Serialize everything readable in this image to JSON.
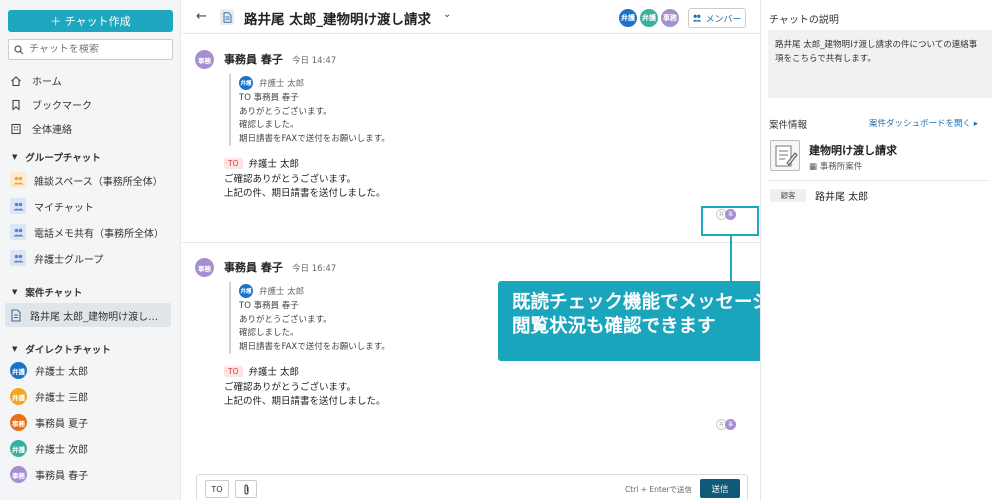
{
  "sidebar": {
    "new_chat_label": "＋ チャット作成",
    "search_placeholder": "チャットを検索",
    "nav": [
      {
        "label": "ホーム",
        "icon": "home-icon"
      },
      {
        "label": "ブックマーク",
        "icon": "bookmark-icon"
      },
      {
        "label": "全体連絡",
        "icon": "building-icon"
      }
    ],
    "group_section": "グループチャット",
    "groups": [
      {
        "label": "雑談スペース（事務所全体）",
        "color": "#f3a33a"
      },
      {
        "label": "マイチャット",
        "color": "#5b86c5"
      },
      {
        "label": "電話メモ共有（事務所全体）",
        "color": "#5b86c5"
      },
      {
        "label": "弁護士グループ",
        "color": "#5b86c5"
      }
    ],
    "case_section": "案件チャット",
    "cases": [
      {
        "label": "路井尾 太郎_建物明け渡し…"
      }
    ],
    "dm_section": "ダイレクトチャット",
    "dms": [
      {
        "avatar": "弁護",
        "label": "弁護士 太郎",
        "color": "#1a73c8"
      },
      {
        "avatar": "弁護",
        "label": "弁護士 三郎",
        "color": "#f4a623"
      },
      {
        "avatar": "事務",
        "label": "事務員 夏子",
        "color": "#e8701a"
      },
      {
        "avatar": "弁護",
        "label": "弁護士 次郎",
        "color": "#3ab0a0"
      },
      {
        "avatar": "事務",
        "label": "事務員 春子",
        "color": "#a58fd0"
      }
    ]
  },
  "header": {
    "back": "←",
    "title": "路井尾 太郎_建物明け渡し請求",
    "chevron": "⌄",
    "members": [
      {
        "label": "弁護",
        "color": "#1a73c8"
      },
      {
        "label": "弁護",
        "color": "#3ab0a0"
      },
      {
        "label": "事務",
        "color": "#a58fd0"
      }
    ],
    "member_btn": "メンバー"
  },
  "messages": [
    {
      "avatar": "事務",
      "name": "事務員 春子",
      "time": "今日 14:47",
      "quote_avatar": "弁護",
      "quote_author": "弁護士 太郎",
      "quote_lines": [
        "TO 事務員 春子",
        "ありがとうございます。",
        "確認しました。",
        "期日請書をFAXで送付をお願いします。"
      ],
      "to_tag": "TO",
      "to_name": "弁護士 太郎",
      "body": [
        "ご確認ありがとうございます。",
        "上記の件、期日請書を送付しました。"
      ],
      "read_marks": [
        "弁",
        "事"
      ]
    },
    {
      "avatar": "事務",
      "name": "事務員 春子",
      "time": "今日 16:47",
      "quote_avatar": "弁護",
      "quote_author": "弁護士 太郎",
      "quote_lines": [
        "TO 事務員 春子",
        "ありがとうございます。",
        "確認しました。",
        "期日請書をFAXで送付をお願いします。"
      ],
      "to_tag": "TO",
      "to_name": "弁護士 太郎",
      "body": [
        "ご確認ありがとうございます。",
        "上記の件、期日請書を送付しました。"
      ],
      "read_marks": [
        "弁",
        "事"
      ]
    }
  ],
  "callout": {
    "line1": "既読チェック機能でメッセージの",
    "line2": "閲覧状況も確認できます"
  },
  "composer": {
    "to_label": "TO",
    "clip_icon": "📎",
    "hint": "Ctrl + Enterで送信",
    "send_label": "送信"
  },
  "right": {
    "desc_title": "チャットの説明",
    "desc_text": "路井尾 太郎_建物明け渡し請求の件についての連絡事項をこちらで共有します。",
    "case_header": "案件情報",
    "dashboard_link": "案件ダッシュボードを開く ▸",
    "case_name": "建物明け渡し請求",
    "case_sub": "事務所案件",
    "client_tag": "顧客",
    "client_name": "路井尾 太郎"
  }
}
